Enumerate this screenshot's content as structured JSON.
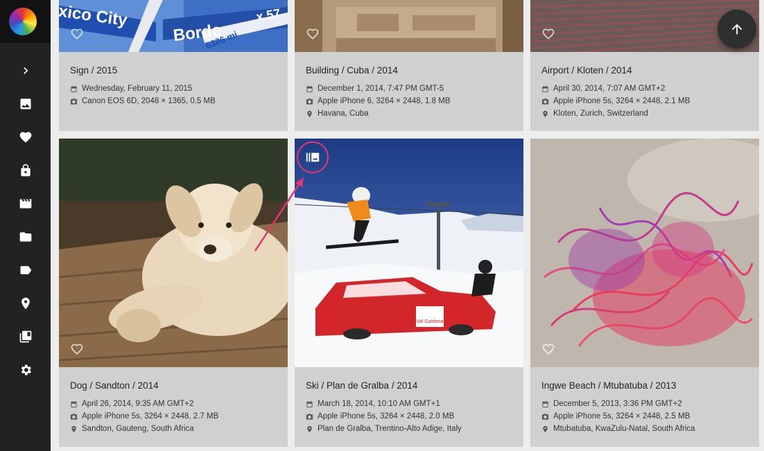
{
  "sidebar": {
    "items": [
      {
        "icon": "chevron-right-icon"
      },
      {
        "icon": "photo-icon"
      },
      {
        "icon": "heart-icon"
      },
      {
        "icon": "lock-icon"
      },
      {
        "icon": "movie-icon"
      },
      {
        "icon": "folder-icon"
      },
      {
        "icon": "label-icon"
      },
      {
        "icon": "place-icon"
      },
      {
        "icon": "album-icon"
      },
      {
        "icon": "settings-icon"
      }
    ]
  },
  "cards": [
    {
      "title": "Sign / 2015",
      "date": "Wednesday, February 11, 2015",
      "camera": "Canon EOS 6D, 2048 × 1365, 0.5 MB",
      "location": "",
      "sign_text_1": "xico City",
      "sign_text_2": "Borde",
      "sign_text_3": "6386 mi",
      "sign_text_4": "x 57"
    },
    {
      "title": "Building / Cuba / 2014",
      "date": "December 1, 2014, 7:47 PM GMT-5",
      "camera": "Apple iPhone 6, 3264 × 2448, 1.8 MB",
      "location": "Havana, Cuba"
    },
    {
      "title": "Airport / Kloten / 2014",
      "date": "April 30, 2014, 7:07 AM GMT+2",
      "camera": "Apple iPhone 5s, 3264 × 2448, 2.1 MB",
      "location": "Kloten, Zurich, Switzerland"
    },
    {
      "title": "Dog / Sandton / 2014",
      "date": "April 26, 2014, 9:35 AM GMT+2",
      "camera": "Apple iPhone 5s, 3264 × 2448, 2.7 MB",
      "location": "Sandton, Gauteng, South Africa"
    },
    {
      "title": "Ski / Plan de Gralba / 2014",
      "date": "March 18, 2014, 10:10 AM GMT+1",
      "camera": "Apple iPhone 5s, 3264 × 2448, 2.0 MB",
      "location": "Plan de Gralba, Trentino-Alto Adige, Italy",
      "car_text": "Val Gardena"
    },
    {
      "title": "Ingwe Beach / Mtubatuba / 2013",
      "date": "December 5, 2013, 3:36 PM GMT+2",
      "camera": "Apple iPhone 5s, 3264 × 2448, 2.5 MB",
      "location": "Mtubatuba, KwaZulu-Natal, South Africa"
    }
  ],
  "fab": {
    "icon": "arrow-up-icon"
  },
  "colors": {
    "sidebar": "#222222",
    "card": "#d0d0d0",
    "accent": "#e5356f"
  }
}
